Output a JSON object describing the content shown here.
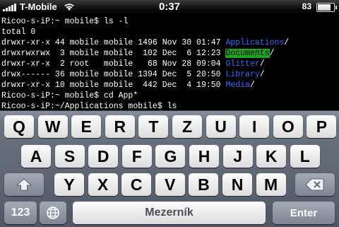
{
  "status_bar": {
    "carrier": "T-Mobile",
    "time": "0:37",
    "battery_percent": "83",
    "battery_level": 0.83,
    "signal_bars": 5,
    "wifi": true
  },
  "terminal": {
    "lines": [
      [
        {
          "t": "Ricoo-s-iP:~ mobile$ ls -l"
        }
      ],
      [
        {
          "t": "total 0"
        }
      ],
      [
        {
          "t": "drwxr-xr-x 44 mobile mobile 1496 Nov 30 01:47 "
        },
        {
          "t": "Applications",
          "c": "blue"
        },
        {
          "t": "/"
        }
      ],
      [
        {
          "t": "drwxrwxrwx  3 mobile mobile  102 Dec  6 12:23 "
        },
        {
          "t": "Documents",
          "c": "green"
        },
        {
          "t": "/"
        }
      ],
      [
        {
          "t": "drwxr-xr-x  2 root   mobile   68 Nov 28 09:04 "
        },
        {
          "t": "Glitter",
          "c": "blue"
        },
        {
          "t": "/"
        }
      ],
      [
        {
          "t": "drwx------ 36 mobile mobile 1394 Dec  5 20:50 "
        },
        {
          "t": "Library",
          "c": "blue"
        },
        {
          "t": "/"
        }
      ],
      [
        {
          "t": "drwxr-xr-x 10 mobile mobile  442 Dec  4 19:50 "
        },
        {
          "t": "Media",
          "c": "blue"
        },
        {
          "t": "/"
        }
      ],
      [
        {
          "t": "Ricoo-s-iP:~ mobile$ cd App*"
        }
      ],
      [
        {
          "t": "Ricoo-s-iP:~/Applications mobile$ ls"
        }
      ]
    ],
    "colors": {
      "blue": "#2f6bff",
      "green": "#1fa21f"
    }
  },
  "keyboard": {
    "row1": [
      "Q",
      "W",
      "E",
      "R",
      "T",
      "Z",
      "U",
      "I",
      "O",
      "P"
    ],
    "row2": [
      "A",
      "S",
      "D",
      "F",
      "G",
      "H",
      "J",
      "K",
      "L"
    ],
    "row3": [
      "Y",
      "X",
      "C",
      "V",
      "B",
      "N",
      "M"
    ],
    "shift_icon": "shift-arrow-icon",
    "backspace_icon": "backspace-icon",
    "globe_icon": "globe-icon",
    "numbers_label": "123",
    "space_label": "Mezerník",
    "enter_label": "Enter"
  }
}
